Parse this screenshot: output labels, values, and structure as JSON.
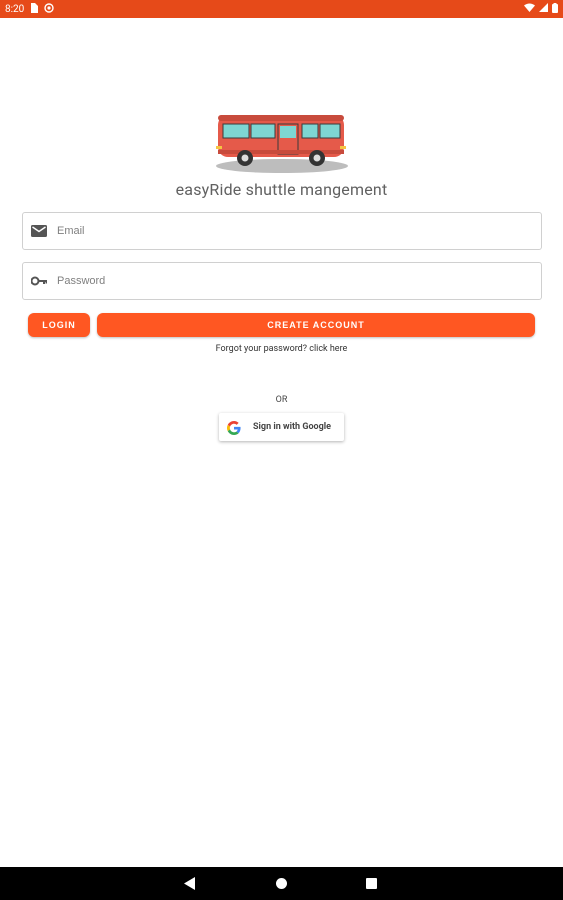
{
  "status_bar": {
    "time": "8:20",
    "icons": [
      "sim-card-icon",
      "at-icon",
      "wifi-icon",
      "signal-icon",
      "battery-icon"
    ]
  },
  "app": {
    "title": "easyRide shuttle mangement",
    "logo": "bus-icon"
  },
  "form": {
    "email_placeholder": "Email",
    "password_placeholder": "Password",
    "email_icon": "mail-icon",
    "password_icon": "key-icon"
  },
  "buttons": {
    "login": "LOGIN",
    "create_account": "CREATE ACCOUNT"
  },
  "forgot_text": "Forgot your password? click here",
  "or_text": "OR",
  "google": {
    "label": "Sign in with Google",
    "icon": "google-icon"
  },
  "nav": {
    "icons": [
      "back-icon",
      "home-icon",
      "recents-icon"
    ]
  },
  "colors": {
    "status_bar": "#E64A19",
    "accent": "#FF5722",
    "nav_bar": "#000000"
  }
}
